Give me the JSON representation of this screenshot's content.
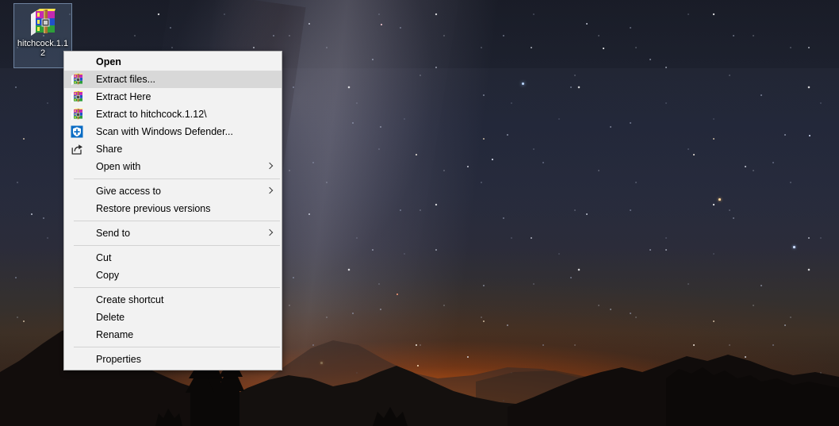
{
  "desktop": {
    "wallpaper_description": "Milky Way night sky over mountain silhouettes with orange horizon glow",
    "colors": {
      "sky_top": "#191c27",
      "sky_mid": "#272b3c",
      "horizon_glow": "#e2600f",
      "silhouette": "#120d0c",
      "selection_fill": "rgba(120,150,190,0.26)",
      "selection_border": "rgba(160,190,225,0.55)"
    },
    "icon": {
      "name": "hitchcock.1.12",
      "label_line_1": "hitchcock.1.1",
      "label_line_2": "2",
      "icon_type": "winrar-archive-icon",
      "selected": true
    }
  },
  "context_menu": {
    "target_file": "hitchcock.1.12",
    "background_color": "#f2f2f2",
    "highlight_color": "#d8d8d8",
    "border_color": "#b3b3b3",
    "items": [
      {
        "id": "open",
        "label": "Open",
        "icon": null,
        "bold": true,
        "submenu": false,
        "highlighted": false,
        "separator_after": false
      },
      {
        "id": "extract-files",
        "label": "Extract files...",
        "icon": "winrar-icon",
        "bold": false,
        "submenu": false,
        "highlighted": true,
        "separator_after": false
      },
      {
        "id": "extract-here",
        "label": "Extract Here",
        "icon": "winrar-icon",
        "bold": false,
        "submenu": false,
        "highlighted": false,
        "separator_after": false
      },
      {
        "id": "extract-to",
        "label": "Extract to hitchcock.1.12\\",
        "icon": "winrar-icon",
        "bold": false,
        "submenu": false,
        "highlighted": false,
        "separator_after": false
      },
      {
        "id": "scan-defender",
        "label": "Scan with Windows Defender...",
        "icon": "shield-icon",
        "bold": false,
        "submenu": false,
        "highlighted": false,
        "separator_after": false
      },
      {
        "id": "share",
        "label": "Share",
        "icon": "share-icon",
        "bold": false,
        "submenu": false,
        "highlighted": false,
        "separator_after": false
      },
      {
        "id": "open-with",
        "label": "Open with",
        "icon": null,
        "bold": false,
        "submenu": true,
        "highlighted": false,
        "separator_after": true
      },
      {
        "id": "give-access-to",
        "label": "Give access to",
        "icon": null,
        "bold": false,
        "submenu": true,
        "highlighted": false,
        "separator_after": false
      },
      {
        "id": "restore-versions",
        "label": "Restore previous versions",
        "icon": null,
        "bold": false,
        "submenu": false,
        "highlighted": false,
        "separator_after": true
      },
      {
        "id": "send-to",
        "label": "Send to",
        "icon": null,
        "bold": false,
        "submenu": true,
        "highlighted": false,
        "separator_after": true
      },
      {
        "id": "cut",
        "label": "Cut",
        "icon": null,
        "bold": false,
        "submenu": false,
        "highlighted": false,
        "separator_after": false
      },
      {
        "id": "copy",
        "label": "Copy",
        "icon": null,
        "bold": false,
        "submenu": false,
        "highlighted": false,
        "separator_after": true
      },
      {
        "id": "create-shortcut",
        "label": "Create shortcut",
        "icon": null,
        "bold": false,
        "submenu": false,
        "highlighted": false,
        "separator_after": false
      },
      {
        "id": "delete",
        "label": "Delete",
        "icon": null,
        "bold": false,
        "submenu": false,
        "highlighted": false,
        "separator_after": false
      },
      {
        "id": "rename",
        "label": "Rename",
        "icon": null,
        "bold": false,
        "submenu": false,
        "highlighted": false,
        "separator_after": true
      },
      {
        "id": "properties",
        "label": "Properties",
        "icon": null,
        "bold": false,
        "submenu": false,
        "highlighted": false,
        "separator_after": false
      }
    ]
  }
}
